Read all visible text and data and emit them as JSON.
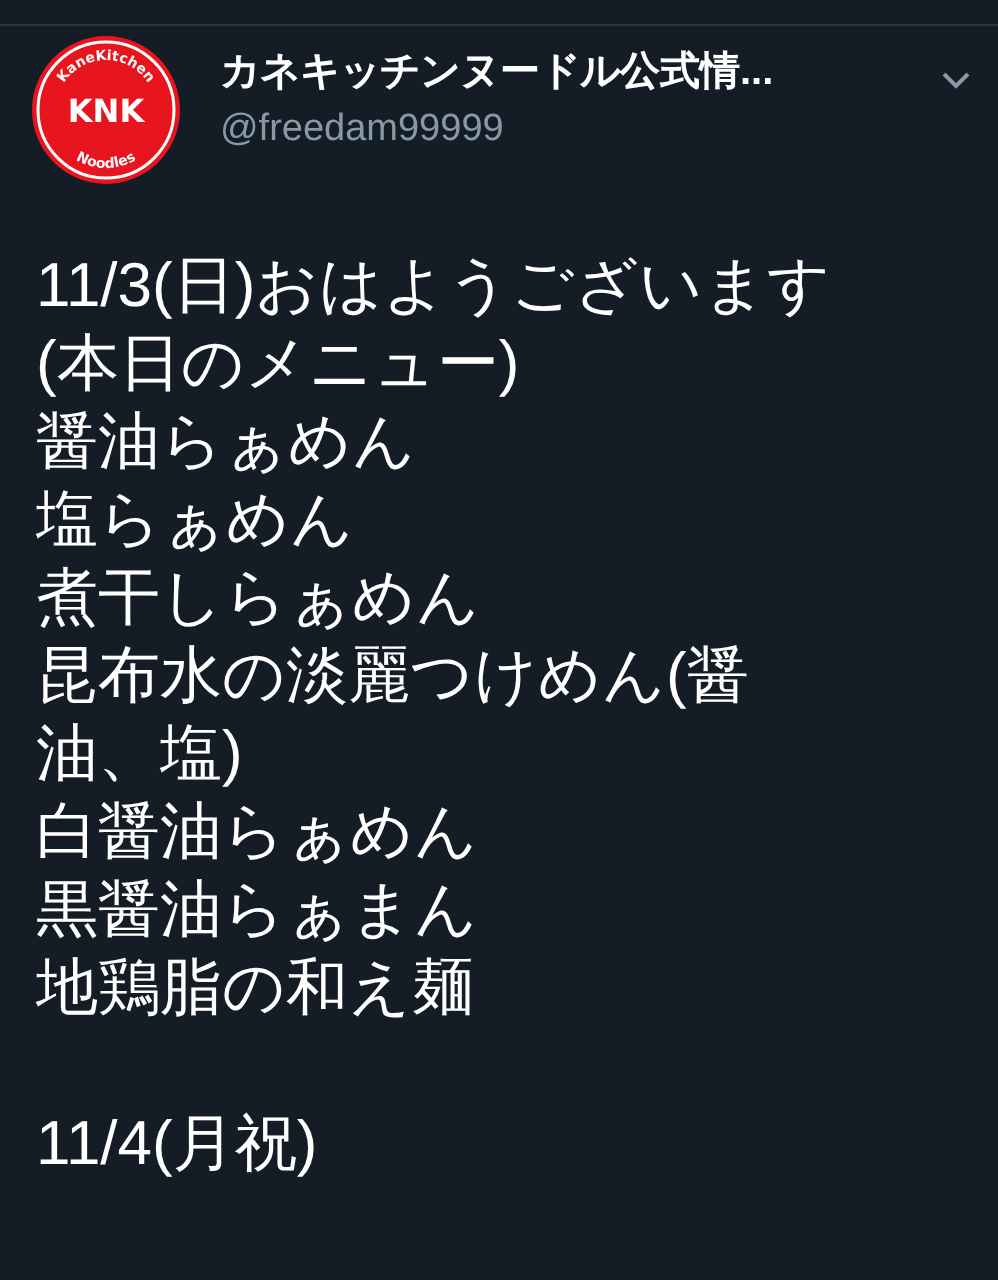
{
  "author": {
    "name": "カネキッチンヌードル公式情...",
    "handle": "@freedam99999",
    "avatar": {
      "ring_top": "KaneKitchen",
      "ring_bottom": "Noodles",
      "mark": "KNK"
    }
  },
  "tweet": {
    "paragraphs": [
      {
        "lines": [
          "11/3(日)おはようございます",
          "(本日のメニュー)",
          "醤油らぁめん",
          "塩らぁめん",
          "煮干しらぁめん",
          "昆布水の淡麗つけめん(醤",
          "油、塩)",
          "白醤油らぁめん",
          "黒醤油らぁまん",
          "地鶏脂の和え麺"
        ]
      },
      {
        "lines": [
          "11/4(月祝)"
        ]
      }
    ]
  }
}
